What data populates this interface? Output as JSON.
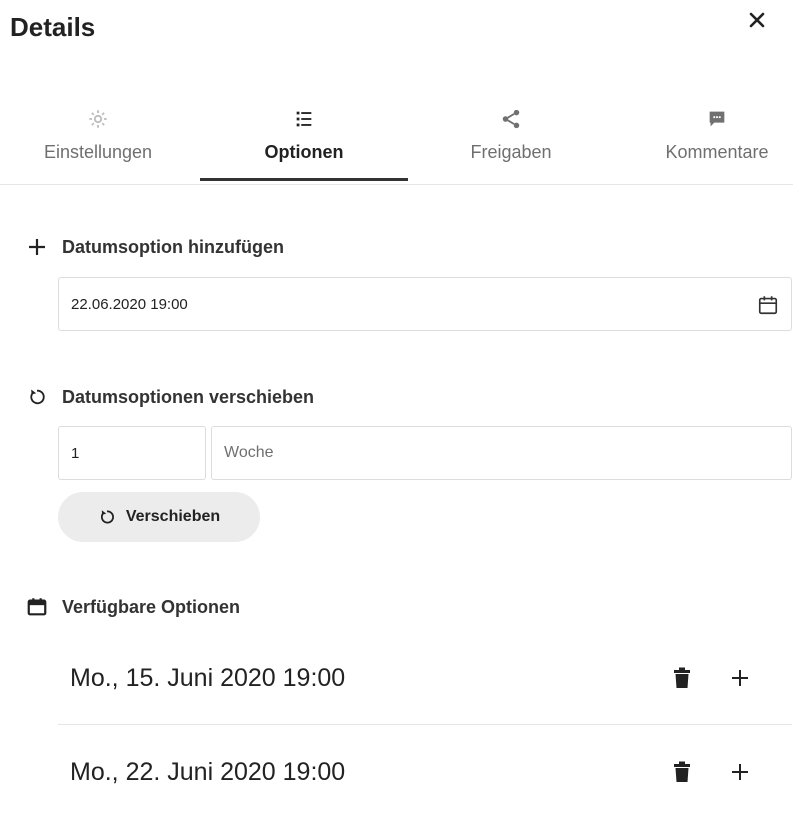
{
  "header": {
    "title": "Details",
    "close_icon": "close-icon"
  },
  "tabs": [
    {
      "label": "Einstellungen",
      "icon": "gear-icon",
      "active": false
    },
    {
      "label": "Optionen",
      "icon": "list-icon",
      "active": true
    },
    {
      "label": "Freigaben",
      "icon": "share-icon",
      "active": false
    },
    {
      "label": "Kommentare",
      "icon": "comment-icon",
      "active": false
    }
  ],
  "add_option": {
    "title": "Datumsoption hinzufügen",
    "date_value": "22.06.2020 19:00",
    "calendar_icon": "calendar-icon"
  },
  "shift_options": {
    "title": "Datumsoptionen verschieben",
    "amount_value": "1",
    "unit_value": "Woche",
    "button_label": "Verschieben"
  },
  "available": {
    "title": "Verfügbare Optionen",
    "options": [
      {
        "label": "Mo., 15. Juni 2020 19:00"
      },
      {
        "label": "Mo., 22. Juni 2020 19:00"
      }
    ]
  },
  "colors": {
    "text": "#222222",
    "muted": "#6f6f6f",
    "icon_muted": "#9a9a9a",
    "button_bg": "#ececec"
  }
}
